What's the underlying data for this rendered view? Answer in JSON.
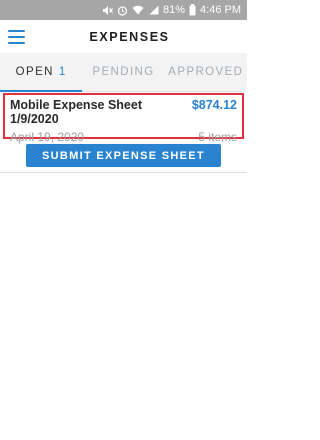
{
  "status_bar": {
    "battery": "81%",
    "time": "4:46 PM"
  },
  "header": {
    "title": "EXPENSES"
  },
  "tabs": [
    {
      "label": "OPEN",
      "count": "1"
    },
    {
      "label": "PENDING"
    },
    {
      "label": "APPROVED"
    }
  ],
  "expense": {
    "title": "Mobile Expense Sheet 1/9/2020",
    "amount": "$874.12",
    "date": "April 19, 2020",
    "items": "5 items"
  },
  "actions": {
    "submit_label": "SUBMIT EXPENSE SHEET"
  },
  "colors": {
    "accent": "#2a83cf",
    "highlight_border": "#e3303f",
    "status_bar": "#a6a6a6"
  }
}
